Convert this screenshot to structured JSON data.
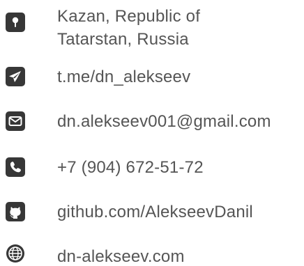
{
  "contacts": {
    "location": {
      "icon": "location-pin-icon",
      "line1": "Kazan, Republic of",
      "line2": "Tatarstan, Russia"
    },
    "telegram": {
      "icon": "telegram-icon",
      "label": "t.me/dn_alekseev"
    },
    "email": {
      "icon": "envelope-icon",
      "label": "dn.alekseev001@gmail.com"
    },
    "phone": {
      "icon": "phone-icon",
      "label": "+7 (904) 672-51-72"
    },
    "github": {
      "icon": "github-icon",
      "label": "github.com/AlekseevDanil"
    },
    "website": {
      "icon": "globe-icon",
      "label": "dn-alekseev.com"
    }
  },
  "colors": {
    "icon_background": "#373737",
    "text": "#555555"
  }
}
